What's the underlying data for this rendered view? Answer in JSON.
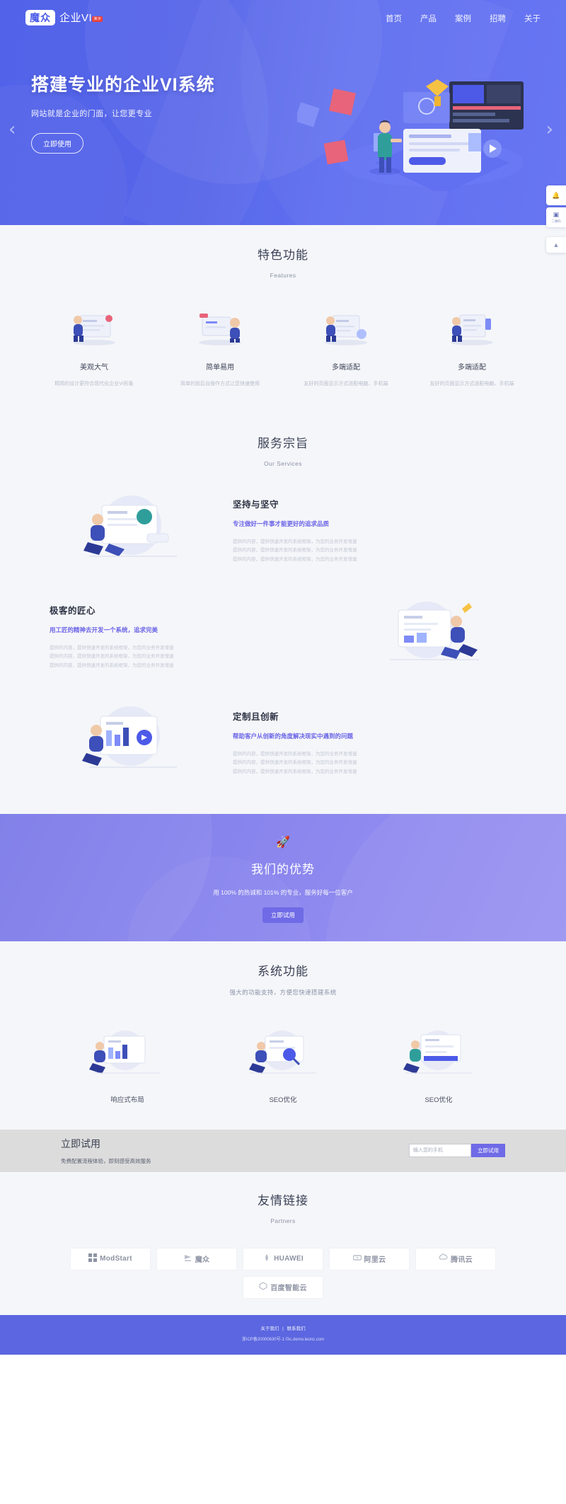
{
  "header": {
    "logo_badge": "魔众",
    "logo_text": "企业VI",
    "logo_sup": "演示",
    "nav": [
      {
        "label": "首页"
      },
      {
        "label": "产品"
      },
      {
        "label": "案例"
      },
      {
        "label": "招聘"
      },
      {
        "label": "关于"
      }
    ]
  },
  "hero": {
    "title": "搭建专业的企业VI系统",
    "subtitle": "网站就是企业的门面，让您更专业",
    "button": "立即使用",
    "prev_icon": "chevron-left-icon",
    "next_icon": "chevron-right-icon"
  },
  "side_widgets": {
    "notice_icon": "bell-icon",
    "qr_icon": "qrcode-icon",
    "qr_label": "二维码",
    "back_to_top_icon": "chevron-up-icon"
  },
  "features": {
    "title": "特色功能",
    "subtitle": "Features",
    "items": [
      {
        "name": "美观大气",
        "desc": "精简的设计更符合现代化企业VI形象"
      },
      {
        "name": "简单易用",
        "desc": "简单的前后台操作方式让您快速使用"
      },
      {
        "name": "多端适配",
        "desc": "友好的页面显示方式适配电脑、手机端"
      },
      {
        "name": "多端适配",
        "desc": "友好的页面显示方式适配电脑、手机端"
      }
    ]
  },
  "services": {
    "title": "服务宗旨",
    "subtitle": "Our Services",
    "items": [
      {
        "heading": "坚持与坚守",
        "subheading": "专注做好一件事才能更好的追求品质",
        "body": "提供的内容，提供快速开发的系统框架，为您的业务开发增速\n提供的内容，提供快速开发的系统框架，为您的业务开发增速\n提供的内容，提供快速开发的系统框架，为您的业务开发增速"
      },
      {
        "heading": "极客的匠心",
        "subheading": "用工匠的精神去开发一个系统，追求完美",
        "body": "提供的内容，提供快速开发的系统框架，为您的业务开发增速\n提供的内容，提供快速开发的系统框架，为您的业务开发增速\n提供的内容，提供快速开发的系统框架，为您的业务开发增速"
      },
      {
        "heading": "定制且创新",
        "subheading": "帮助客户从创新的角度解决现实中遇到的问题",
        "body": "提供的内容，提供快速开发的系统框架，为您的业务开发增速\n提供的内容，提供快速开发的系统框架，为您的业务开发增速\n提供的内容，提供快速开发的系统框架，为您的业务开发增速"
      }
    ]
  },
  "advantage": {
    "icon": "rocket-icon",
    "title": "我们的优势",
    "subtitle": "用 100% 的热诚和 101% 的专业，服务好每一位客户",
    "button": "立即试用"
  },
  "system_functions": {
    "title": "系统功能",
    "subtitle": "强大的功能支持，方便您快速搭建系统",
    "items": [
      {
        "name": "响应式布局"
      },
      {
        "name": "SEO优化"
      },
      {
        "name": "SEO优化"
      }
    ]
  },
  "trial": {
    "title": "立即试用",
    "desc": "免费配置流程体验，即刻感受高效服务",
    "placeholder": "输入您的手机",
    "input_value": "",
    "button": "立即试用"
  },
  "partners": {
    "title": "友情链接",
    "subtitle": "Partners",
    "items": [
      {
        "label": "ModStart",
        "icon": "modstart-logo-icon"
      },
      {
        "label": "魔众",
        "icon": "mozhong-logo-icon"
      },
      {
        "label": "HUAWEI",
        "icon": "huawei-logo-icon"
      },
      {
        "label": "阿里云",
        "icon": "aliyun-logo-icon"
      },
      {
        "label": "腾讯云",
        "icon": "tencentcloud-logo-icon"
      },
      {
        "label": "百度智能云",
        "icon": "baiducloud-logo-icon"
      }
    ]
  },
  "footer": {
    "link1": "关于我们",
    "divider": "|",
    "link2": "联系我们",
    "copyright": "浙ICP备20000630号-1 ©ic.demo.leonz.com"
  },
  "colors": {
    "brand": "#4b5ce8",
    "accent": "#6f6ae6",
    "hero_gradient_start": "#4b5ce8",
    "hero_gradient_end": "#6472f2"
  }
}
